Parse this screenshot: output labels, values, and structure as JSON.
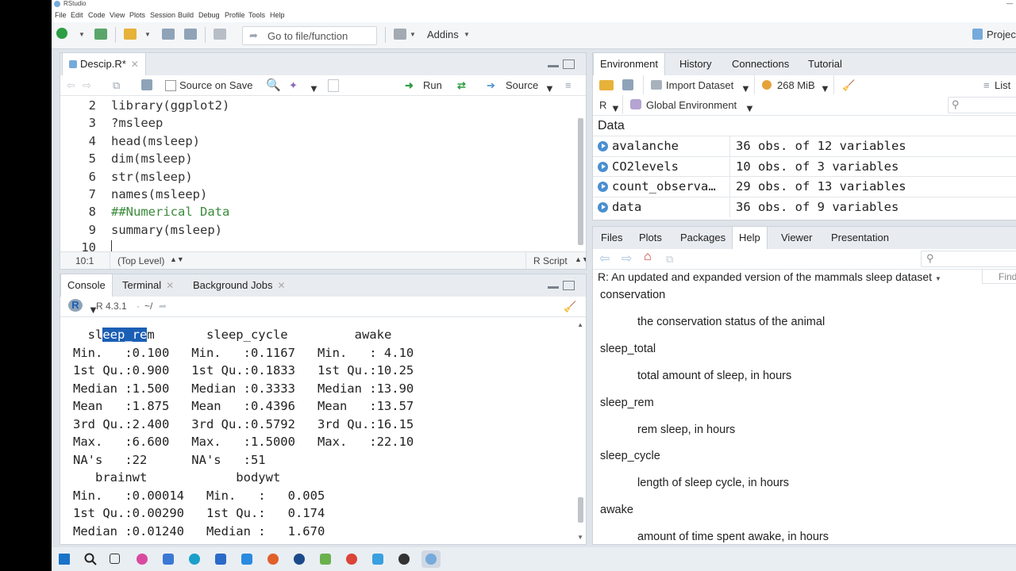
{
  "app_title": "RStudio",
  "menu": [
    "File",
    "Edit",
    "Code",
    "View",
    "Plots",
    "Session",
    "Build",
    "Debug",
    "Profile",
    "Tools",
    "Help"
  ],
  "toolbar": {
    "goto_placeholder": "Go to file/function",
    "addins": "Addins",
    "project": "Projec"
  },
  "editor": {
    "tab": "Descip.R*",
    "source_on_save": "Source on Save",
    "run": "Run",
    "source": "Source",
    "lines": [
      {
        "n": "2",
        "text": "library(ggplot2)",
        "type": "code"
      },
      {
        "n": "3",
        "text": "?msleep",
        "type": "code"
      },
      {
        "n": "4",
        "text": "head(msleep)",
        "type": "code"
      },
      {
        "n": "5",
        "text": "dim(msleep)",
        "type": "code"
      },
      {
        "n": "6",
        "text": "str(msleep)",
        "type": "code"
      },
      {
        "n": "7",
        "text": "names(msleep)",
        "type": "code"
      },
      {
        "n": "8",
        "text": "##Numerical Data",
        "type": "comment"
      },
      {
        "n": "9",
        "text": "summary(msleep)",
        "type": "code"
      },
      {
        "n": "10",
        "text": "",
        "type": "code"
      }
    ],
    "status_pos": "10:1",
    "status_scope": "(Top Level)",
    "status_lang": "R Script"
  },
  "console": {
    "tabs": [
      "Console",
      "Terminal",
      "Background Jobs"
    ],
    "version": "R 4.3.1",
    "path": "~/",
    "highlight": {
      "before": "  sl",
      "selected": "eep_re",
      "after": "m       sleep_cycle         awake"
    },
    "lines": [
      "Min.   :0.100   Min.   :0.1167   Min.   : 4.10",
      "1st Qu.:0.900   1st Qu.:0.1833   1st Qu.:10.25",
      "Median :1.500   Median :0.3333   Median :13.90",
      "Mean   :1.875   Mean   :0.4396   Mean   :13.57",
      "3rd Qu.:2.400   3rd Qu.:0.5792   3rd Qu.:16.15",
      "Max.   :6.600   Max.   :1.5000   Max.   :22.10",
      "NA's   :22      NA's   :51",
      "   brainwt            bodywt",
      "Min.   :0.00014   Min.   :   0.005",
      "1st Qu.:0.00290   1st Qu.:   0.174",
      "Median :0.01240   Median :   1.670"
    ]
  },
  "env": {
    "tabs": [
      "Environment",
      "History",
      "Connections",
      "Tutorial"
    ],
    "import": "Import Dataset",
    "memory": "268 MiB",
    "list": "List",
    "lang": "R",
    "scope": "Global Environment",
    "section": "Data",
    "rows": [
      {
        "name": "avalanche",
        "value": "36 obs. of 12 variables"
      },
      {
        "name": "CO2levels",
        "value": "10 obs. of 3 variables"
      },
      {
        "name": "count_observa…",
        "value": "29 obs. of 13 variables"
      },
      {
        "name": "data",
        "value": "36 obs. of 9 variables"
      }
    ]
  },
  "help": {
    "tabs": [
      "Files",
      "Plots",
      "Packages",
      "Help",
      "Viewer",
      "Presentation"
    ],
    "title": "R: An updated and expanded version of the mammals sleep dataset",
    "find": "Find",
    "entries": [
      {
        "term": "conservation",
        "desc": "the conservation status of the animal"
      },
      {
        "term": "sleep_total",
        "desc": "total amount of sleep, in hours"
      },
      {
        "term": "sleep_rem",
        "desc": "rem sleep, in hours"
      },
      {
        "term": "sleep_cycle",
        "desc": "length of sleep cycle, in hours"
      },
      {
        "term": "awake",
        "desc": "amount of time spent awake, in hours"
      }
    ]
  },
  "colors": {
    "accent": "#1a5fb4",
    "run_green": "#2e9e44",
    "comment": "#3a8a3a"
  }
}
